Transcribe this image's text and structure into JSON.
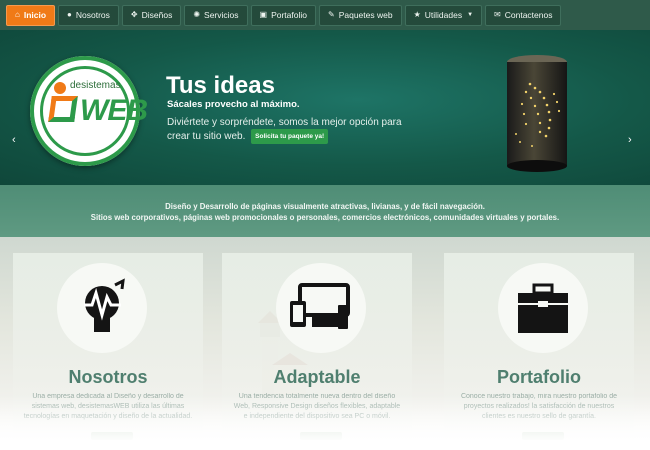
{
  "nav": {
    "items": [
      {
        "label": "Inicio",
        "icon": "home-icon",
        "active": true
      },
      {
        "label": "Nosotros",
        "icon": "globe-icon"
      },
      {
        "label": "Diseños",
        "icon": "move-icon"
      },
      {
        "label": "Servicios",
        "icon": "gear-icon"
      },
      {
        "label": "Portafolio",
        "icon": "briefcase-icon"
      },
      {
        "label": "Paquetes web",
        "icon": "edit-icon"
      },
      {
        "label": "Utilidades",
        "icon": "star-icon",
        "dropdown": true
      },
      {
        "label": "Contactenos",
        "icon": "envelope-icon"
      }
    ]
  },
  "logo": {
    "small": "desistemas",
    "big": "WEB"
  },
  "hero": {
    "title": "Tus ideas",
    "subtitle": "Sácales provecho al máximo.",
    "body": "Diviértete y sorpréndete, somos la mejor opción para crear tu sitio web.",
    "button": "Solicita tu paquete ya!"
  },
  "band": {
    "line1": "Diseño y Desarrollo de páginas visualmente atractivas, livianas, y de fácil navegación.",
    "line2": "Sitios web corporativos, páginas web promocionales o personales, comercios electrónicos, comunidades virtuales y portales."
  },
  "cards": [
    {
      "title": "Nosotros",
      "icon": "lightbulb-icon",
      "text": "Una empresa dedicada al Diseño y desarrollo de sistemas web, desistemasWEB utiliza las últimas tecnologías en maquetación y diseño de la actualidad."
    },
    {
      "title": "Adaptable",
      "icon": "devices-icon",
      "text": "Una tendencia totalmente nueva dentro del diseño Web, Responsive Design diseños flexibles, adaptable e independiente del dispositivo sea PC o móvil."
    },
    {
      "title": "Portafolio",
      "icon": "briefcase-icon",
      "text": "Conoce nuestro trabajo, mira nuestro portafolio de proyectos realizados! la satisfacción de nuestros clientes es nuestro sello de garantía."
    }
  ],
  "colors": {
    "accent": "#f07a17",
    "brand_green": "#2d9a4a",
    "nav": "#2f5a4a"
  }
}
